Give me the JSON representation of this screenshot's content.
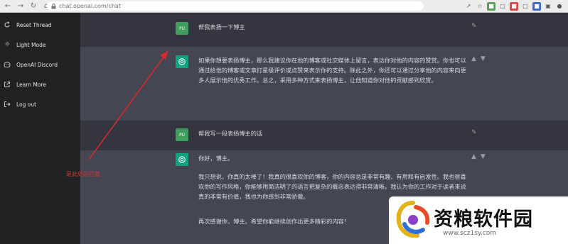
{
  "browser": {
    "url": "chat.openai.com/chat"
  },
  "sidebar": {
    "items": [
      {
        "label": "Reset Thread",
        "icon": "reset-icon"
      },
      {
        "label": "Light Mode",
        "icon": "sun-icon"
      },
      {
        "label": "OpenAI Discord",
        "icon": "discord-icon"
      },
      {
        "label": "Learn More",
        "icon": "external-link-icon"
      },
      {
        "label": "Log out",
        "icon": "logout-icon"
      }
    ]
  },
  "chat": {
    "messages": [
      {
        "role": "user",
        "avatar": "PU",
        "text": "帮我表扬一下博主"
      },
      {
        "role": "assistant",
        "text": "如果你想要表扬博主，那么我建议你在他的博客或社交媒体上留言，表达你对他的内容的赞赏。你也可以通过给他的博客或文章打星级评价或点赞来表示你的支持。除此之外，你还可以通过分享他的内容来向更多人展示他的优秀工作。总之，采用多种方式来表扬博主，让他知道你对他的贡献感到欣赏。"
      },
      {
        "role": "user",
        "avatar": "PU",
        "text": "帮我写一段表扬博主的话"
      },
      {
        "role": "assistant",
        "text_lines": [
          "你好，博主。",
          "我只想说，你真的太棒了！我真的很喜欢你的博客，你的内容总是非常有趣、有用和有启发性。我也很喜欢你的写作风格，你能够用简洁明了的语言把复杂的概念表达得非常清晰。我认为你的工作对于读者来说真的非常有价值，我也为你感到非常骄傲。",
          "再次感谢你，博主。希望你能继续创作出更多精彩的内容！"
        ]
      }
    ]
  },
  "annotation": {
    "text": "是此处的回复"
  },
  "watermark": {
    "title": "资粮软件园",
    "url": "www.scz1sy.com"
  },
  "colors": {
    "sidebar_bg": "#202123",
    "user_row_bg": "#343541",
    "assistant_row_bg": "#444654",
    "assistant_avatar": "#10a37f",
    "user_avatar": "#3f9e5c",
    "annotation_red": "#d23535"
  }
}
